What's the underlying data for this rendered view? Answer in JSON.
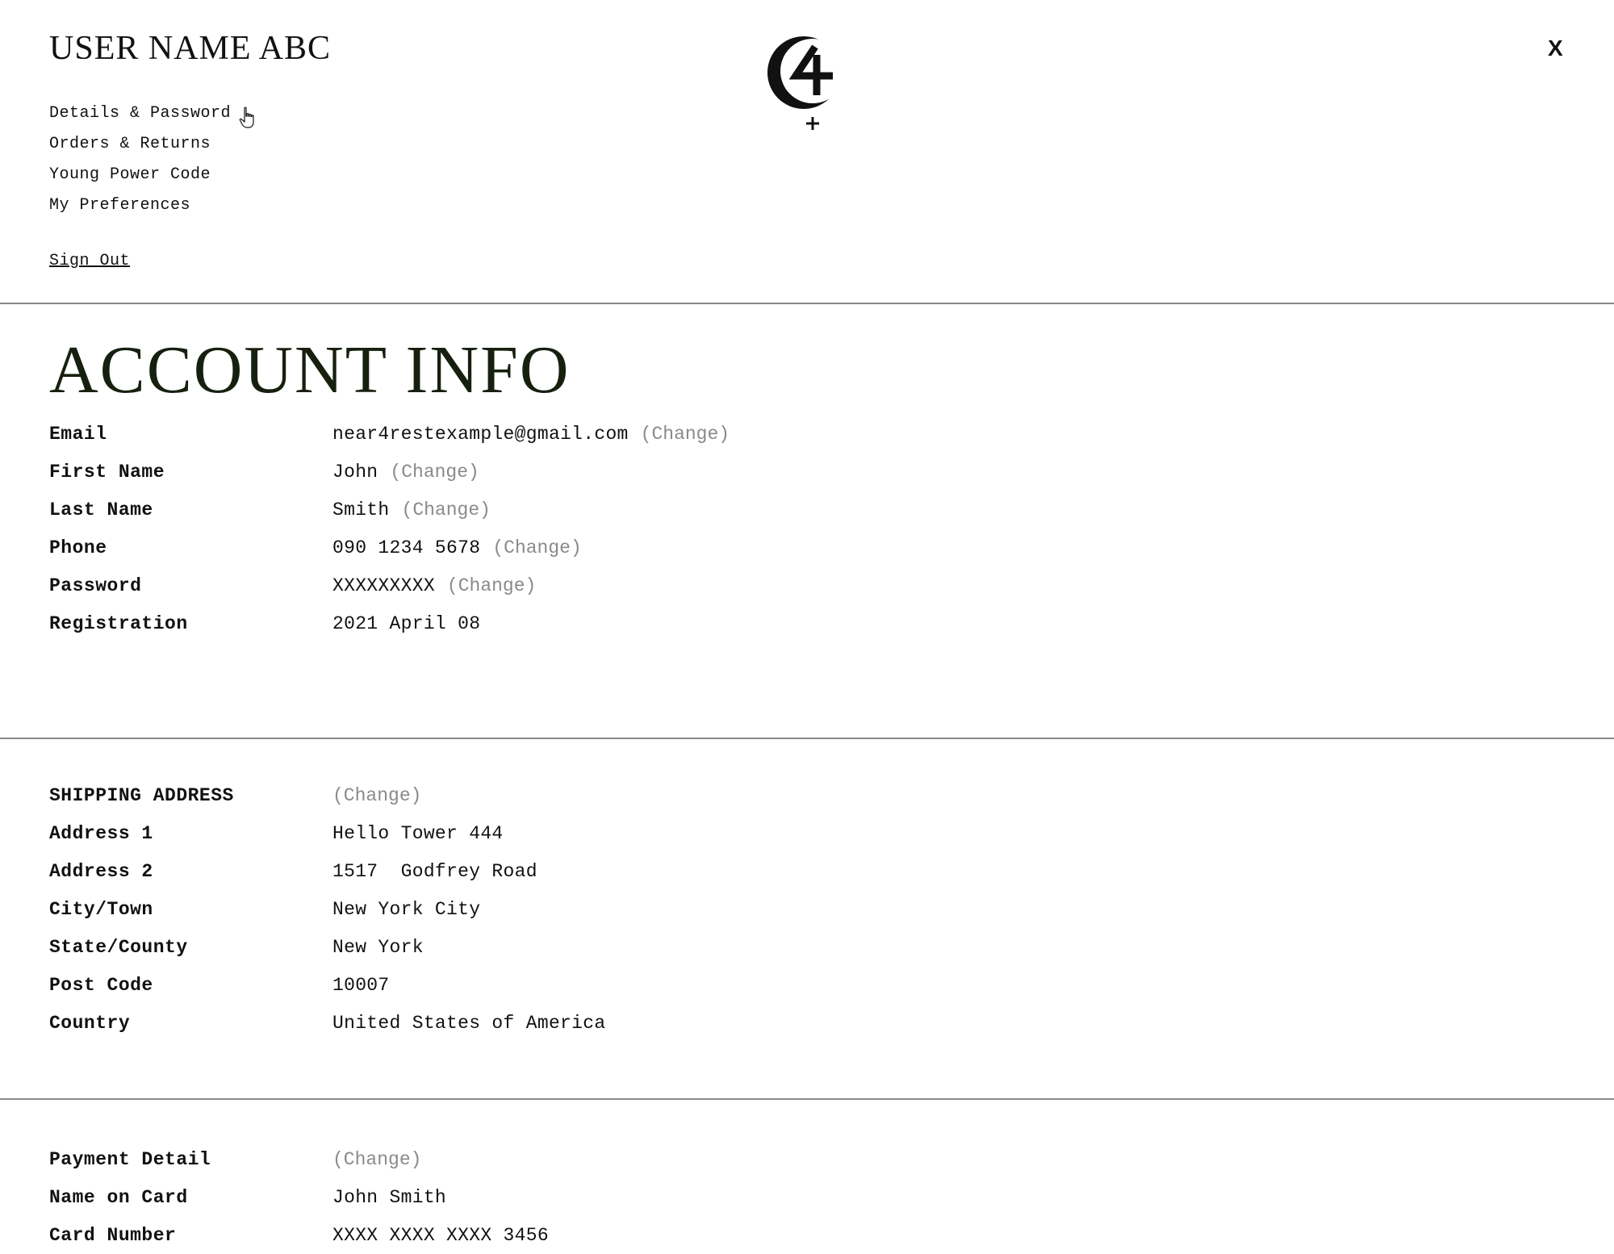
{
  "header": {
    "user_name": "USER NAME ABC",
    "close_label": "X",
    "logo_alt": "C4+"
  },
  "nav": {
    "items": [
      {
        "label": "Details & Password"
      },
      {
        "label": "Orders & Returns"
      },
      {
        "label": "Young Power Code"
      },
      {
        "label": "My Preferences"
      }
    ],
    "sign_out": "Sign Out"
  },
  "page_title": "ACCOUNT INFO",
  "change_label": "(Change)",
  "account": {
    "rows": [
      {
        "label": "Email",
        "value": "near4restexample@gmail.com",
        "changeable": true
      },
      {
        "label": "First Name",
        "value": "John",
        "changeable": true
      },
      {
        "label": "Last Name",
        "value": "Smith",
        "changeable": true
      },
      {
        "label": "Phone",
        "value": "090 1234 5678",
        "changeable": true
      },
      {
        "label": "Password",
        "value": "XXXXXXXXX",
        "changeable": true
      },
      {
        "label": "Registration",
        "value": "2021 April 08",
        "changeable": false
      }
    ]
  },
  "shipping": {
    "heading": "SHIPPING ADDRESS",
    "rows": [
      {
        "label": "Address 1",
        "value": "Hello Tower 444"
      },
      {
        "label": "Address 2",
        "value": "1517  Godfrey Road"
      },
      {
        "label": "City/Town",
        "value": "New York City"
      },
      {
        "label": "State/County",
        "value": "New York"
      },
      {
        "label": "Post Code",
        "value": "10007"
      },
      {
        "label": "Country",
        "value": "United States of America"
      }
    ]
  },
  "payment": {
    "heading": "Payment Detail",
    "rows": [
      {
        "label": "Name on Card",
        "value": "John Smith"
      },
      {
        "label": "Card Number",
        "value": "XXXX XXXX XXXX 3456"
      }
    ]
  }
}
